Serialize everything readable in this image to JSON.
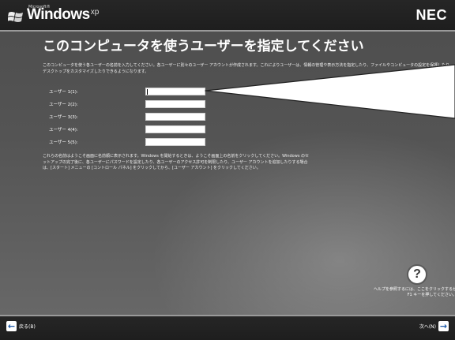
{
  "header": {
    "ms_label": "Microsoft®",
    "brand_word": "Windows",
    "brand_xp": "xp",
    "vendor": "NEC"
  },
  "page": {
    "title": "このコンピュータを使うユーザーを指定してください",
    "intro": "このコンピュータを使う各ユーザーの名前を入力してください。各ユーザーに別々のユーザー アカウントが作成されます。これによりユーザーは、情報の管理や表示方法を指定したり、ファイルやコンピュータの設定を保護したり、デスクトップをカスタマイズしたりできるようになります。",
    "after_text": "これらの名前はようこそ画面に名前順に表示されます。Windows を開始するときは、ようこそ画面上の名前をクリックしてください。Windows のセットアップの完了後に、各ユーザーにパスワードを設定したり、各ユーザーのアクセス許可を制限したり、ユーザー アカウントを追加したりする場合は、[スタート] メニューの [コントロール パネル] をクリックしてから、[ユーザー アカウント] をクリックしてください。"
  },
  "users": [
    {
      "label": "ユーザー 1(1):",
      "value": ""
    },
    {
      "label": "ユーザー 2(2):",
      "value": ""
    },
    {
      "label": "ユーザー 3(3):",
      "value": ""
    },
    {
      "label": "ユーザー 4(4):",
      "value": ""
    },
    {
      "label": "ユーザー 5(5):",
      "value": ""
    }
  ],
  "help": {
    "icon": "question-mark-icon",
    "text": "ヘルプを参照するには、ここをクリックするか F1 キーを押してください。"
  },
  "footer": {
    "back_label": "戻る(B)",
    "next_label": "次へ(N)"
  }
}
